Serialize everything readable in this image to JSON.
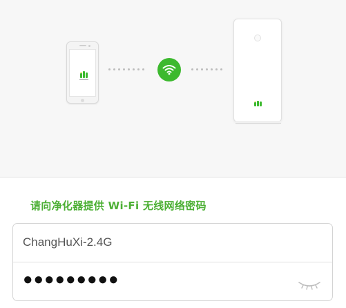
{
  "prompt": "请向净化器提供 Wi-Fi 无线网络密码",
  "ssid": {
    "value": "ChangHuXi-2.4G"
  },
  "password": {
    "value": "●●●●●●●●●"
  },
  "icons": {
    "phone": "phone-icon",
    "wifi": "wifi-icon",
    "purifier": "air-purifier-icon",
    "eye": "eye-closed-icon"
  },
  "colors": {
    "accent": "#3cb92e",
    "prompt_text": "#4caf34"
  }
}
